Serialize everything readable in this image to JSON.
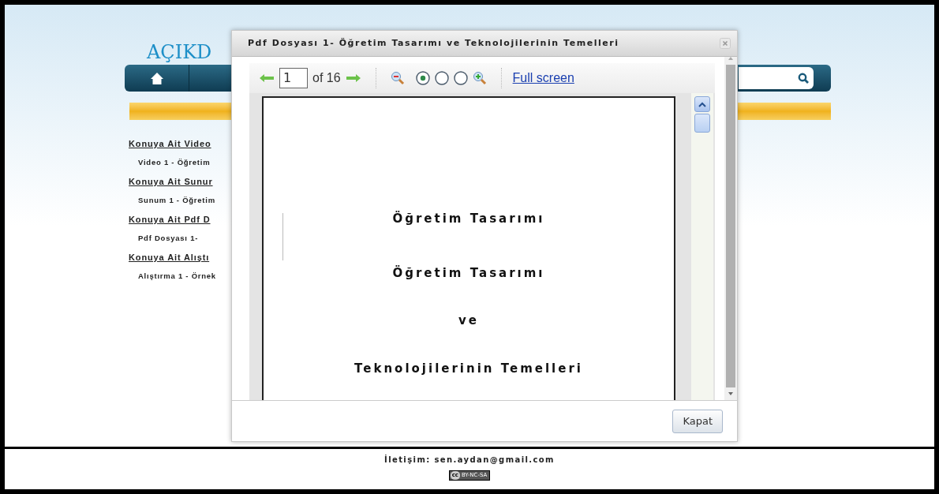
{
  "site": {
    "logo": "AÇIKD"
  },
  "sidebar": [
    {
      "heading": "Konuya Ait Video",
      "items": [
        "Video 1 - Öğretim"
      ]
    },
    {
      "heading": "Konuya Ait Sunur",
      "items": [
        "Sunum 1 - Öğretim"
      ]
    },
    {
      "heading": "Konuya Ait Pdf D",
      "items": [
        "Pdf Dosyası 1-"
      ]
    },
    {
      "heading": "Konuya Ait Alıştı",
      "items": [
        "Alıştırma 1 - Örnek"
      ]
    }
  ],
  "dialog": {
    "title": "Pdf Dosyası 1- Öğretim Tasarımı ve Teknolojilerinin Temelleri",
    "toolbar": {
      "page": "1",
      "page_count": "of 16",
      "zoom_options": [
        {
          "selected": true
        },
        {
          "selected": false
        },
        {
          "selected": false
        }
      ],
      "full_screen": "Full screen"
    },
    "document": {
      "lines": [
        "Öğretim Tasarımı",
        "Öğretim Tasarımı",
        "ve",
        "Teknolojilerinin Temelleri"
      ]
    },
    "buttons": [
      "Kapat"
    ]
  },
  "footer": {
    "contact": "İletişim: sen.aydan@gmail.com",
    "license": {
      "cc": "cc",
      "terms": "BY-NC-SA"
    }
  }
}
